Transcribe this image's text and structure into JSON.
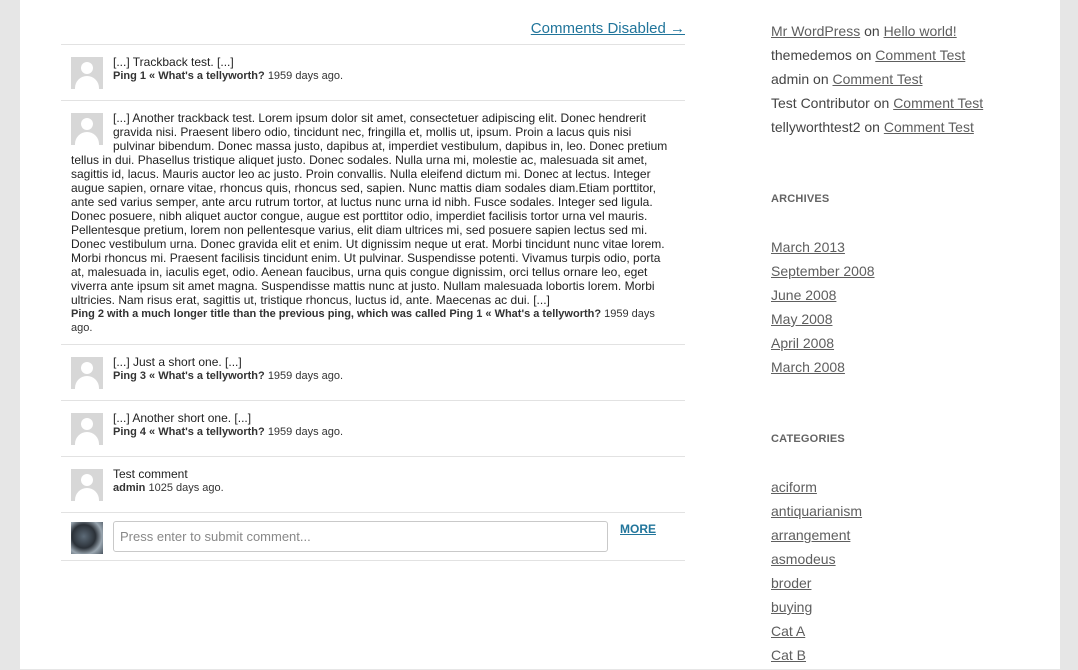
{
  "main": {
    "comments_disabled": "Comments Disabled →",
    "comments": [
      {
        "text": "[...] Trackback test. [...]",
        "title": "Ping 1 « What's a tellyworth?",
        "age": "1959 days ago."
      },
      {
        "text": "[...] Another trackback test.  Lorem ipsum dolor sit amet, consectetuer adipiscing elit. Donec hendrerit gravida nisi. Praesent libero odio, tincidunt nec, fringilla et, mollis ut, ipsum. Proin a lacus quis nisi pulvinar bibendum. Donec massa justo, dapibus at, imperdiet vestibulum, dapibus in, leo. Donec pretium tellus in dui. Phasellus tristique aliquet justo. Donec sodales. Nulla urna mi, molestie ac, malesuada sit amet, sagittis id, lacus. Mauris auctor leo ac justo. Proin convallis. Nulla eleifend dictum mi. Donec at lectus. Integer augue sapien, ornare vitae, rhoncus quis, rhoncus sed, sapien. Nunc mattis diam sodales diam.Etiam porttitor, ante sed varius semper, ante arcu rutrum tortor, at luctus nunc urna id nibh. Fusce sodales. Integer sed ligula. Donec posuere, nibh aliquet auctor congue, augue est porttitor odio, imperdiet facilisis tortor urna vel mauris. Pellentesque pretium, lorem non pellentesque varius, elit diam ultrices mi, sed posuere sapien lectus sed mi. Donec vestibulum urna. Donec gravida elit et enim. Ut dignissim neque ut erat. Morbi tincidunt nunc vitae lorem. Morbi rhoncus mi. Praesent facilisis tincidunt enim. Ut pulvinar. Suspendisse potenti. Vivamus turpis odio, porta at, malesuada in, iaculis eget, odio. Aenean faucibus, urna quis congue dignissim, orci tellus ornare leo, eget viverra ante ipsum sit amet magna. Suspendisse mattis nunc at justo. Nullam malesuada lobortis lorem. Morbi ultricies. Nam risus erat, sagittis ut, tristique rhoncus, luctus id, ante. Maecenas ac dui. [...]",
        "title": "Ping 2 with a much longer title than the previous ping, which was called Ping 1 « What's a tellyworth?",
        "age": "1959 days ago."
      },
      {
        "text": "[...] Just a short one. [...]",
        "title": "Ping 3 « What's a tellyworth?",
        "age": "1959 days ago."
      },
      {
        "text": "[...] Another short one. [...]",
        "title": "Ping 4 « What's a tellyworth?",
        "age": "1959 days ago."
      },
      {
        "text": "Test comment",
        "title": "admin",
        "age": "1025 days ago."
      }
    ],
    "reply_placeholder": "Press enter to submit comment...",
    "more_label": "MORE"
  },
  "sidebar": {
    "recent_comments": [
      {
        "author": "Mr WordPress",
        "on": "on",
        "post": "Hello world!",
        "author_link": true
      },
      {
        "author": "themedemos",
        "on": "on",
        "post": "Comment Test",
        "author_link": false
      },
      {
        "author": "admin",
        "on": "on",
        "post": "Comment Test",
        "author_link": false
      },
      {
        "author": "Test Contributor",
        "on": "on",
        "post": "Comment Test",
        "author_link": false
      },
      {
        "author": "tellyworthtest2",
        "on": "on",
        "post": "Comment Test",
        "author_link": false
      }
    ],
    "archives_title": "ARCHIVES",
    "archives": [
      "March 2013",
      "September 2008",
      "June 2008",
      "May 2008",
      "April 2008",
      "March 2008"
    ],
    "categories_title": "CATEGORIES",
    "categories": [
      "aciform",
      "antiquarianism",
      "arrangement",
      "asmodeus",
      "broder",
      "buying",
      "Cat A",
      "Cat B"
    ]
  }
}
